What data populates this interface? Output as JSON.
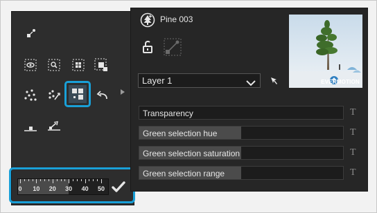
{
  "object": {
    "name": "Pine 003",
    "thumbnail_brand": "EVERMOTION"
  },
  "layer": {
    "selected": "Layer 1"
  },
  "properties": [
    {
      "label": "Transparency",
      "level": 0
    },
    {
      "label": "Green selection hue",
      "level": 0.5
    },
    {
      "label": "Green selection saturation",
      "level": 0.5
    },
    {
      "label": "Green selection range",
      "level": 0.5
    }
  ],
  "scale": {
    "labels": [
      "0",
      "10",
      "20",
      "30",
      "40",
      "50"
    ],
    "value": 30
  },
  "colors": {
    "accent": "#19a0d8",
    "panel": "#2d2d2d",
    "field": "#1c1c1c",
    "text": "#e6e6e6"
  },
  "icons": {
    "tools_row1": [
      "scatter-single-icon"
    ],
    "tools_row2": [
      "select-eye-icon",
      "select-zoom-icon",
      "select-grid-icon",
      "select-fill-icon"
    ],
    "tools_row3": [
      "scatter-random-icon",
      "scatter-spray-icon",
      "scatter-layout-icon",
      "undo-icon"
    ],
    "tools_row4": [
      "place-flat-icon",
      "place-up-icon"
    ]
  }
}
